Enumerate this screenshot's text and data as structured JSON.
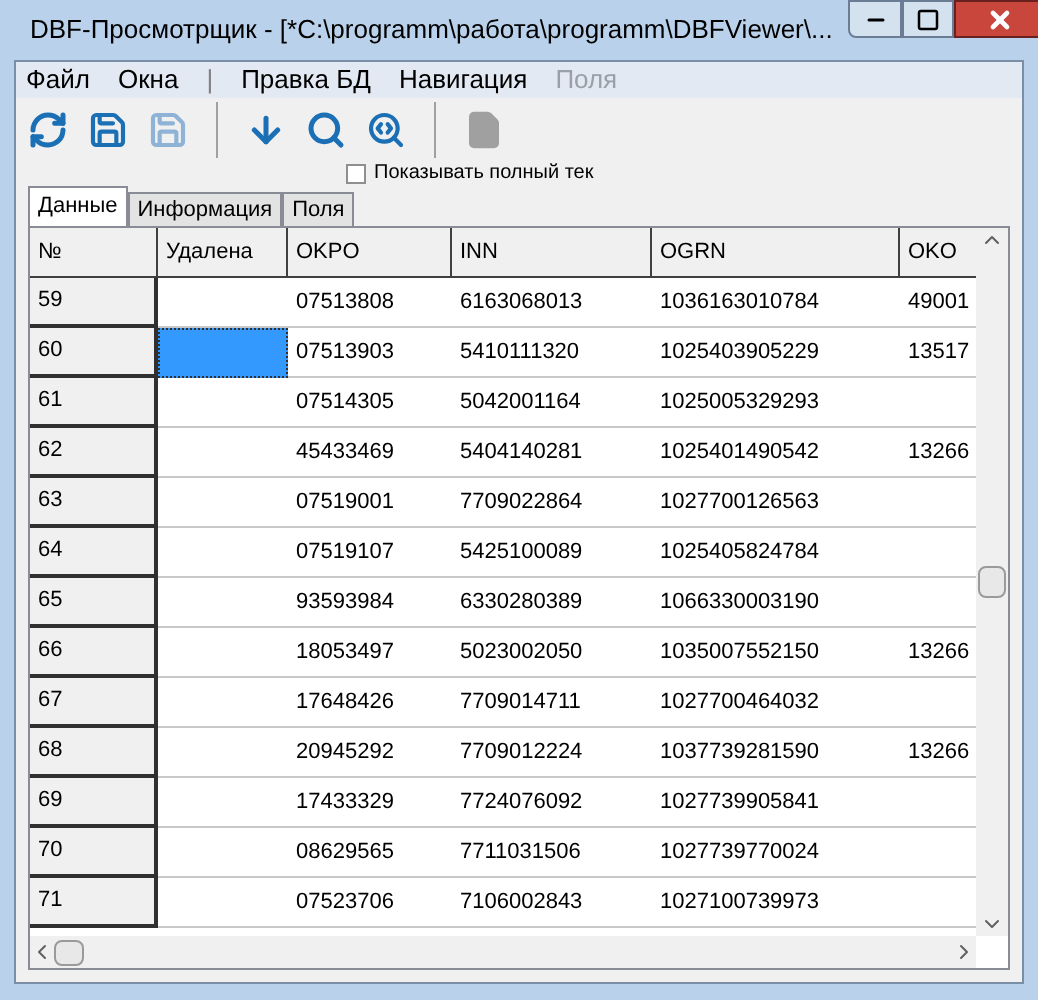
{
  "window": {
    "title": "DBF-Просмотрщик - [*C:\\programm\\работа\\programm\\DBFViewer\\..."
  },
  "menu": [
    {
      "label": "Файл",
      "disabled": false,
      "kind": "item"
    },
    {
      "label": "Окна",
      "disabled": false,
      "kind": "item"
    },
    {
      "label": "|",
      "kind": "separator"
    },
    {
      "label": "Правка БД",
      "disabled": false,
      "kind": "item"
    },
    {
      "label": "Навигация",
      "disabled": false,
      "kind": "item"
    },
    {
      "label": "Поля",
      "disabled": true,
      "kind": "item"
    }
  ],
  "toolbar_groups": [
    [
      {
        "kind": "refresh",
        "disabled": false
      },
      {
        "kind": "save",
        "disabled": false
      },
      {
        "kind": "save",
        "disabled": true
      }
    ],
    [
      {
        "kind": "goto",
        "disabled": false
      },
      {
        "kind": "search",
        "disabled": false
      },
      {
        "kind": "search-next",
        "disabled": false
      }
    ],
    [
      {
        "kind": "page",
        "disabled": true
      }
    ]
  ],
  "option": {
    "label": "Показывать полный тек",
    "checked": false
  },
  "tabs": [
    {
      "label": "Данные",
      "selected": true
    },
    {
      "label": "Информация",
      "selected": false
    },
    {
      "label": "Поля",
      "selected": false
    }
  ],
  "table": {
    "columns": [
      "№",
      "Удалена",
      "OKPO",
      "INN",
      "OGRN",
      "OKO"
    ],
    "rows": [
      {
        "cells": [
          "59",
          "",
          "07513808",
          "6163068013",
          "1036163010784",
          "49001"
        ],
        "selected": false
      },
      {
        "cells": [
          "60",
          "",
          "07513903",
          "5410111320",
          "1025403905229",
          "13517"
        ],
        "selected": true
      },
      {
        "cells": [
          "61",
          "",
          "07514305",
          "5042001164",
          "1025005329293",
          ""
        ],
        "selected": false
      },
      {
        "cells": [
          "62",
          "",
          "45433469",
          "5404140281",
          "1025401490542",
          "13266"
        ],
        "selected": false
      },
      {
        "cells": [
          "63",
          "",
          "07519001",
          "7709022864",
          "1027700126563",
          ""
        ],
        "selected": false
      },
      {
        "cells": [
          "64",
          "",
          "07519107",
          "5425100089",
          "1025405824784",
          ""
        ],
        "selected": false
      },
      {
        "cells": [
          "65",
          "",
          "93593984",
          "6330280389",
          "1066330003190",
          ""
        ],
        "selected": false
      },
      {
        "cells": [
          "66",
          "",
          "18053497",
          "5023002050",
          "1035007552150",
          "13266"
        ],
        "selected": false
      },
      {
        "cells": [
          "67",
          "",
          "17648426",
          "7709014711",
          "1027700464032",
          ""
        ],
        "selected": false
      },
      {
        "cells": [
          "68",
          "",
          "20945292",
          "7709012224",
          "1037739281590",
          "13266"
        ],
        "selected": false
      },
      {
        "cells": [
          "69",
          "",
          "17433329",
          "7724076092",
          "1027739905841",
          ""
        ],
        "selected": false
      },
      {
        "cells": [
          "70",
          "",
          "08629565",
          "7711031506",
          "1027739770024",
          ""
        ],
        "selected": false
      },
      {
        "cells": [
          "71",
          "",
          "07523706",
          "7106002843",
          "1027100739973",
          ""
        ],
        "selected": false
      }
    ]
  }
}
